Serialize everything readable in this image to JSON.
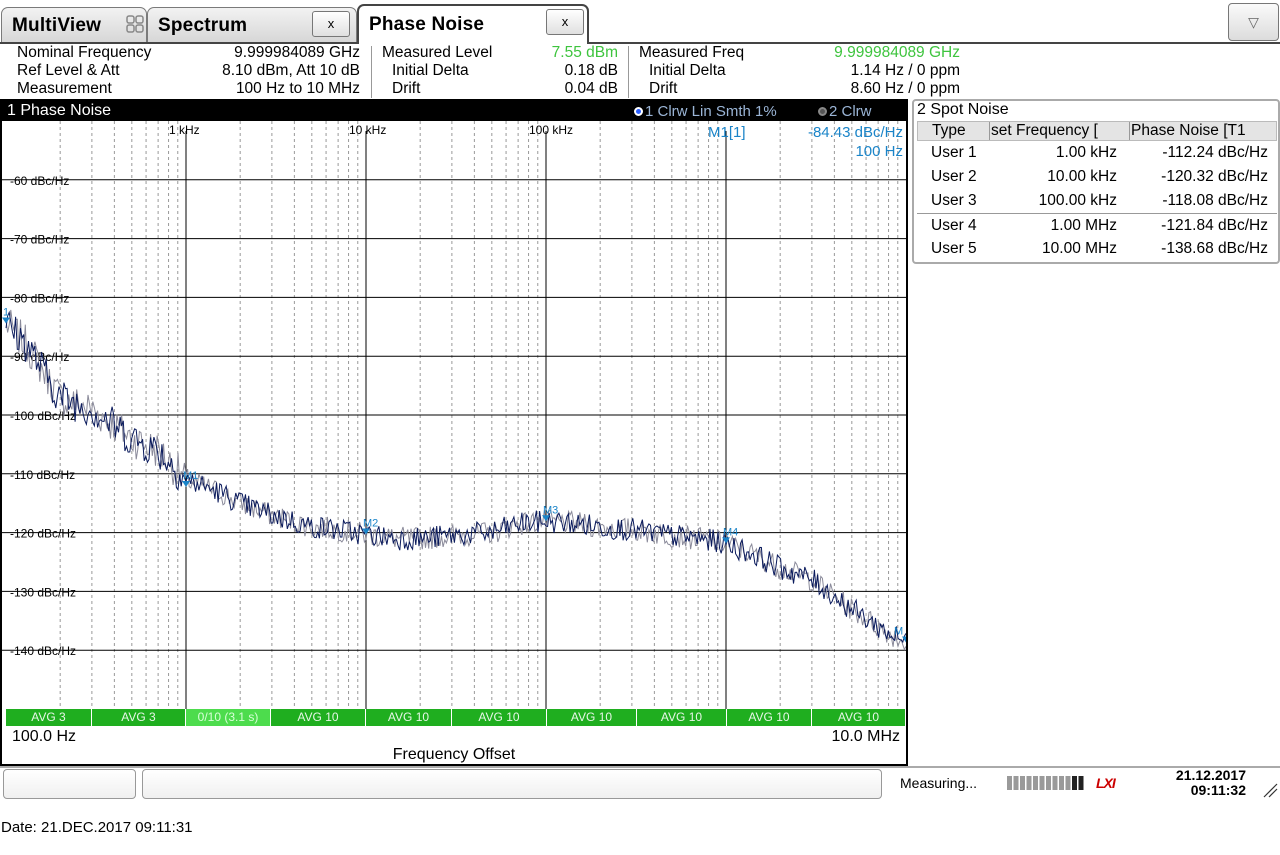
{
  "tabs": [
    {
      "label": "MultiView"
    },
    {
      "label": "Spectrum",
      "close": "x"
    },
    {
      "label": "Phase Noise",
      "close": "x"
    }
  ],
  "dropdown_glyph": "▽",
  "info": {
    "col1": [
      {
        "label": "Nominal Frequency",
        "value": "9.999984089 GHz"
      },
      {
        "label": "Ref Level & Att",
        "value": "8.10 dBm, Att 10 dB"
      },
      {
        "label": "Measurement",
        "value": "100 Hz to 10 MHz"
      }
    ],
    "col2": [
      {
        "label": "Measured Level",
        "value": "7.55 dBm"
      },
      {
        "label": "Initial Delta",
        "value": "0.18 dB"
      },
      {
        "label": "Drift",
        "value": "0.04 dB"
      }
    ],
    "col3": [
      {
        "label": "Measured Freq",
        "value": "9.999984089 GHz"
      },
      {
        "label": "Initial Delta",
        "value": "1.14 Hz / 0 ppm"
      },
      {
        "label": "Drift",
        "value": "8.60 Hz / 0 ppm"
      }
    ]
  },
  "pn_window": {
    "title": "1 Phase Noise",
    "trace1": "1 Clrw Lin Smth 1%",
    "trace2": "2 Clrw",
    "marker_readout": {
      "name": "M1[1]",
      "value": "-84.43 dBc/Hz",
      "freq": "100 Hz"
    },
    "x_start": "100.0 Hz",
    "x_stop": "10.0 MHz",
    "x_title": "Frequency Offset",
    "avg_segments": [
      "AVG 3",
      "AVG 3",
      "0/10 (3.1 s)",
      "AVG 10",
      "AVG 10",
      "AVG 10",
      "AVG 10",
      "AVG 10",
      "AVG 10",
      "AVG 10"
    ]
  },
  "chart_data": {
    "type": "line",
    "x_scale": "log",
    "xlim": [
      100,
      10000000
    ],
    "ylim": [
      -150,
      -50
    ],
    "x_tick_labels": [
      "1 kHz",
      "10 kHz",
      "100 kHz"
    ],
    "x_ticks": [
      1000,
      10000,
      100000
    ],
    "y_tick_labels": [
      "-60 dBc/Hz",
      "-70 dBc/Hz",
      "-80 dBc/Hz",
      "-90 dBc/Hz",
      "-100 dBc/Hz",
      "-110 dBc/Hz",
      "-120 dBc/Hz",
      "-130 dBc/Hz",
      "-140 dBc/Hz"
    ],
    "y_ticks": [
      -60,
      -70,
      -80,
      -90,
      -100,
      -110,
      -120,
      -130,
      -140
    ],
    "grid": true,
    "series": [
      {
        "color": "#0a1a5c",
        "x": [
          100,
          130,
          200,
          300,
          500,
          700,
          1000,
          1500,
          2000,
          3000,
          5000,
          7000,
          10000,
          15000,
          20000,
          30000,
          50000,
          70000,
          100000,
          150000,
          200000,
          300000,
          500000,
          700000,
          1000000,
          1500000,
          2000000,
          3000000,
          5000000,
          7000000,
          10000000
        ],
        "y": [
          -84.4,
          -88,
          -97,
          -99,
          -104,
          -106,
          -111,
          -113,
          -115,
          -117,
          -119,
          -119.5,
          -120.3,
          -121,
          -121,
          -120.5,
          -120,
          -118.5,
          -118.1,
          -118.5,
          -119,
          -119.5,
          -120.5,
          -121,
          -121.8,
          -124,
          -126,
          -128,
          -133,
          -136,
          -138.7
        ]
      }
    ],
    "markers": [
      {
        "label": "1",
        "x": 100,
        "y": -84.43
      },
      {
        "label": "M1",
        "x": 1000,
        "y": -112.24
      },
      {
        "label": "M2",
        "x": 10000,
        "y": -120.32
      },
      {
        "label": "M3",
        "x": 100000,
        "y": -118.08
      },
      {
        "label": "M4",
        "x": 1000000,
        "y": -121.84
      },
      {
        "label": "M",
        "x": 10000000,
        "y": -138.68
      }
    ]
  },
  "spot_noise": {
    "title": "2 Spot Noise",
    "headers": [
      "Type",
      "set Frequency [",
      "Phase Noise [T1"
    ],
    "rows": [
      {
        "type": "User 1",
        "freq": "1.00 kHz",
        "noise": "-112.24 dBc/Hz"
      },
      {
        "type": "User 2",
        "freq": "10.00 kHz",
        "noise": "-120.32 dBc/Hz"
      },
      {
        "type": "User 3",
        "freq": "100.00 kHz",
        "noise": "-118.08 dBc/Hz"
      },
      {
        "type": "User 4",
        "freq": "1.00 MHz",
        "noise": "-121.84 dBc/Hz"
      },
      {
        "type": "User 5",
        "freq": "10.00 MHz",
        "noise": "-138.68 dBc/Hz"
      }
    ]
  },
  "status": {
    "measuring": "Measuring...",
    "logo": "LXI",
    "date": "21.12.2017",
    "time": "09:11:32"
  },
  "footer_date": "Date: 21.DEC.2017  09:11:31",
  "colors": {
    "measured": "#3ec43e",
    "marker": "#1a84c8",
    "avg_bar": "#1fae1f",
    "title_bar": "#000000"
  }
}
